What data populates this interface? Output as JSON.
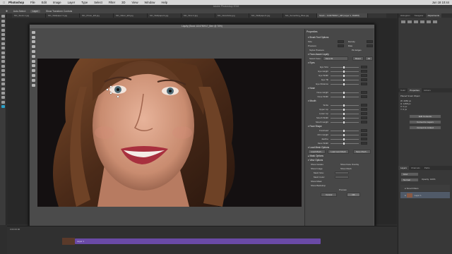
{
  "menubar": {
    "apple": "",
    "app": "Photoshop",
    "items": [
      "File",
      "Edit",
      "Image",
      "Layer",
      "Type",
      "Select",
      "Filter",
      "3D",
      "View",
      "Window",
      "Help"
    ],
    "clock": "Jun 18 10:44"
  },
  "app_title": "Adobe Photoshop 2016",
  "options": {
    "tool_label": "Auto-Select:",
    "layer_value": "Layer",
    "transform": "Show Transform Controls"
  },
  "doc_tabs": [
    "MC_Stock 1.jpg",
    "MC_Wallpaper 3.jpg",
    "MC_Photo_ED.jpg",
    "MC_Nikon_ED.jpg",
    "MC_Wallpaper1.jpg",
    "MC_Shot 2.jpg",
    "MC_Glosshole.jpg",
    "MC_Wallpaper1.jpg",
    "MC_Something_Blue.jpg",
    "Stock – 1134750917_GB (Layer 1, RGB/8)"
  ],
  "dialog": {
    "title": "Liquify (Stock 1134750917_Berr @ 76%)",
    "zoom": "37.3%",
    "zoom_unit": "76%"
  },
  "properties": {
    "title": "Properties",
    "brush_tool_options": "Brush Tool Options",
    "brush_rows": [
      {
        "l": "Size",
        "r": "Density"
      },
      {
        "l": "Pressure",
        "r": "Rate"
      }
    ],
    "stylus": "Stylus Pressure",
    "pin_edges": "Pin Edges",
    "face_aware": "Face-Aware Liquify",
    "select_face_label": "Select Face:",
    "select_face_value": "Face #1",
    "reset": "Reset",
    "all": "All",
    "eyes": "Eyes",
    "eye_rows": [
      "Eye Size",
      "Eye Height",
      "Eye Width",
      "Eye Tilt",
      "Eye Distance"
    ],
    "nose": "Nose",
    "nose_rows": [
      "Nose Height",
      "Nose Width"
    ],
    "mouth": "Mouth",
    "mouth_rows": [
      "Smile",
      "Upper Lip",
      "Lower Lip",
      "Mouth Width",
      "Mouth Height"
    ],
    "face_shape": "Face Shape",
    "face_rows": [
      "Forehead",
      "Chin Height",
      "Jawline",
      "Face Width"
    ],
    "load_mesh": "Load Mesh Options",
    "load_btns": [
      "Load Mesh...",
      "Load Last Mesh",
      "Save Mesh..."
    ],
    "mask": "Mask Options",
    "view": "View Options",
    "view_opts": [
      "Show Guides",
      "Show Face Overlay",
      "Show Image",
      "Show Mesh"
    ],
    "mesh_size": "Mesh Size:",
    "mesh_color": "Mesh Color:",
    "mask_color": "Show Mask",
    "backdrop": "Show Backdrop",
    "preview": "Preview",
    "cancel": "Cancel",
    "ok": "OK"
  },
  "right_panel": {
    "top_tabs": [
      "Histogram",
      "Navigator",
      "Adjustments"
    ],
    "mid_tabs": [
      "Color",
      "Properties",
      "Actions"
    ],
    "props_title": "Placed Smart Object",
    "props_rows": [
      "W: 2050 px",
      "H: 1458 px",
      "X: 0 px",
      "Y: 0 px"
    ],
    "props_btns": [
      "Edit Contents",
      "Convert to Layers",
      "Convert to Linked"
    ],
    "layers_tabs": [
      "Layers",
      "Channels",
      "Paths"
    ],
    "kind": "Kind",
    "normal": "Normal",
    "opacity": "Opacity: 100%",
    "layers": [
      {
        "name": "Smart Filters"
      },
      {
        "name": "Layer 1"
      }
    ]
  },
  "timeline": {
    "clip_label": "Layer 1",
    "time": "0:00:00:00"
  }
}
